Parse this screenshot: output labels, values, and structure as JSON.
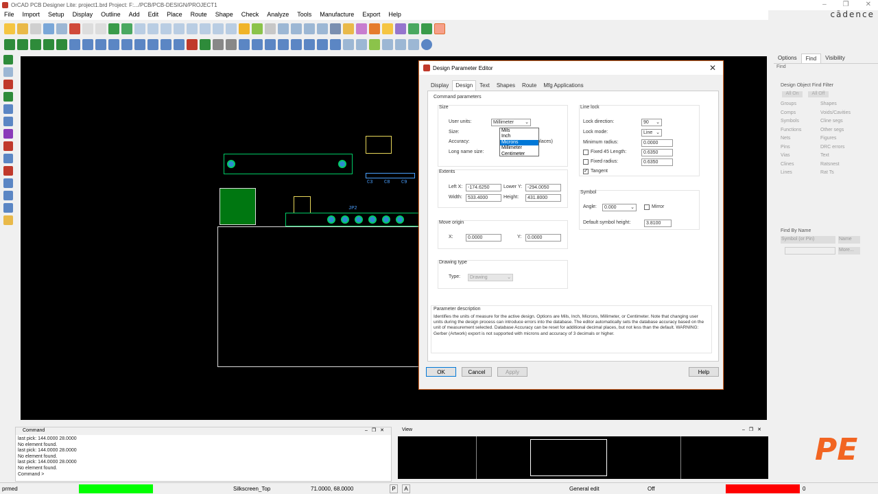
{
  "window": {
    "title": "OrCAD PCB Designer Lite: project1.brd  Project: F:.../PCB/PCB-DESIGN/PROJECT1",
    "brand": "cādence"
  },
  "menu": [
    "File",
    "Import",
    "Setup",
    "Display",
    "Outline",
    "Add",
    "Edit",
    "Place",
    "Route",
    "Shape",
    "Check",
    "Analyze",
    "Tools",
    "Manufacture",
    "Export",
    "Help"
  ],
  "canvas": {
    "refdes": [
      "C3",
      "C8",
      "C9",
      "JP2"
    ]
  },
  "right_panel": {
    "tabs": [
      "Options",
      "Find",
      "Visibility"
    ],
    "active_tab": "Find",
    "find_header": "Find",
    "filter_title": "Design Object Find Filter",
    "all_on": "All On",
    "all_off": "All Off",
    "col1": [
      "Groups",
      "Comps",
      "Symbols",
      "Functions",
      "Nets",
      "Pins",
      "Vias",
      "Clines",
      "Lines"
    ],
    "col2": [
      "Shapes",
      "Voids/Cavities",
      "Cline segs",
      "Other segs",
      "Figures",
      "DRC errors",
      "Text",
      "Ratsnest",
      "Rat Ts"
    ],
    "find_by_name": "Find By Name",
    "symbol_or_pin": "Symbol (or Pin)",
    "name": "Name",
    "more": "More..."
  },
  "command": {
    "title": "Command",
    "log": [
      "last pick:  144.0000 28.0000",
      "No element found.",
      "last pick:  144.0000 28.0000",
      "No element found.",
      "last pick:  144.0000 28.0000",
      "No element found.",
      "Command >"
    ]
  },
  "view": {
    "title": "View"
  },
  "status": {
    "left": "prmed",
    "layer": "Silkscreen_Top",
    "coords": "71.0000, 68.0000",
    "p": "P",
    "a": "A",
    "mode": "General edit",
    "off": "Off",
    "count": "0"
  },
  "dialog": {
    "title": "Design Parameter Editor",
    "tabs": [
      "Display",
      "Design",
      "Text",
      "Shapes",
      "Route",
      "Mfg Applications"
    ],
    "active_tab": "Design",
    "command_parameters": "Command parameters",
    "size_group": "Size",
    "user_units_label": "User units:",
    "user_units_value": "Millimeter",
    "size_label": "Size:",
    "accuracy_label": "Accuracy:",
    "accuracy_hint": "al places)",
    "long_name_label": "Long name size:",
    "units_options": [
      "Mils",
      "Inch",
      "Microns",
      "Millimeter",
      "Centimeter"
    ],
    "units_highlight": "Microns",
    "extents_group": "Extents",
    "left_x_label": "Left X:",
    "left_x": "-174.6250",
    "lower_y_label": "Lower Y:",
    "lower_y": "-294.0050",
    "width_label": "Width:",
    "width": "533.4000",
    "height_label": "Height:",
    "height": "431.8000",
    "move_origin_group": "Move origin",
    "x_label": "X:",
    "x": "0.0000",
    "y_label": "Y:",
    "y": "0.0000",
    "drawing_type_group": "Drawing type",
    "type_label": "Type:",
    "type_value": "Drawing",
    "line_lock_group": "Line lock",
    "lock_direction_label": "Lock direction:",
    "lock_direction": "90",
    "lock_mode_label": "Lock mode:",
    "lock_mode": "Line",
    "min_radius_label": "Minimum radius:",
    "min_radius": "0.0000",
    "fixed45_label": "Fixed 45 Length:",
    "fixed45": "0.6350",
    "fixed_radius_label": "Fixed radius:",
    "fixed_radius": "0.6350",
    "tangent_label": "Tangent",
    "symbol_group": "Symbol",
    "angle_label": "Angle:",
    "angle": "0.000",
    "mirror_label": "Mirror",
    "default_symbol_height_label": "Default symbol height:",
    "default_symbol_height": "3.8100",
    "param_desc_title": "Parameter description",
    "param_desc": "Identifies the units of measure for the active design. Options are Mils, Inch, Microns, Millimeter, or Centimeter. Note that changing user units during the design process can introduce errors into the database.  The editor automatically sets the database accuracy based on the unit of measurement selected. Database Accuracy can be reset for additional decimal places, but not less than the default. WARNING: Gerber (Artwork) export is not supported with microns and accuracy of 3 decimals or higher.",
    "ok": "OK",
    "cancel": "Cancel",
    "apply": "Apply",
    "help": "Help"
  },
  "colors": {
    "accent": "#e06e2d",
    "logo": "#f26522",
    "status_green": "#00ff00",
    "status_red": "#ff0000"
  }
}
